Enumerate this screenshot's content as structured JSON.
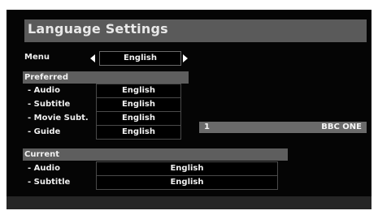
{
  "title": "Language Settings",
  "menu": {
    "label": "Menu",
    "value": "English"
  },
  "preferred": {
    "header": "Preferred",
    "rows": [
      {
        "label": "- Audio",
        "value": "English"
      },
      {
        "label": "- Subtitle",
        "value": "English"
      },
      {
        "label": "- Movie Subt.",
        "value": "English"
      },
      {
        "label": "- Guide",
        "value": "English"
      }
    ]
  },
  "channel": {
    "number": "1",
    "name": "BBC ONE"
  },
  "current": {
    "header": "Current",
    "rows": [
      {
        "label": "- Audio",
        "value": "English"
      },
      {
        "label": "- Subtitle",
        "value": "English"
      }
    ]
  }
}
